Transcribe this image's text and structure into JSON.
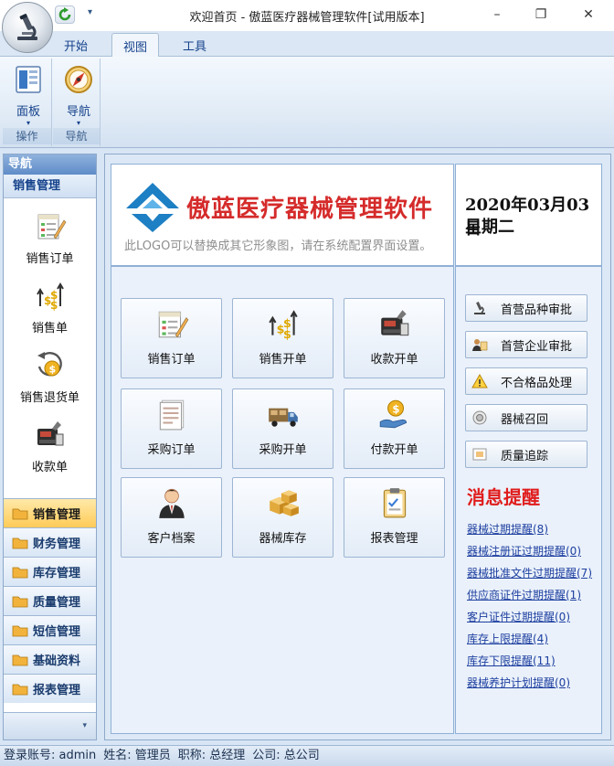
{
  "window": {
    "title": "欢迎首页 - 傲蓝医疗器械管理软件[试用版本]",
    "minimize": "–",
    "maximize": "❐",
    "close": "✕",
    "quick_access_dropdown": "▾"
  },
  "ribbon": {
    "tabs": [
      "开始",
      "视图",
      "工具"
    ],
    "active_tab": "视图",
    "groups": [
      {
        "label": "操作",
        "button": "面板",
        "icon": "panel-icon"
      },
      {
        "label": "导航",
        "button": "导航",
        "icon": "compass-icon"
      }
    ],
    "dropdown_arrow": "▾"
  },
  "nav": {
    "header": "导航",
    "section": "销售管理",
    "items": [
      {
        "label": "销售订单",
        "icon": "sales-order-icon"
      },
      {
        "label": "销售单",
        "icon": "sales-slip-icon"
      },
      {
        "label": "销售退货单",
        "icon": "sales-return-icon"
      },
      {
        "label": "收款单",
        "icon": "cash-register-icon"
      }
    ],
    "categories": [
      "销售管理",
      "财务管理",
      "库存管理",
      "质量管理",
      "短信管理",
      "基础资料",
      "报表管理"
    ],
    "active_category": "销售管理",
    "footer_arrow": "▾"
  },
  "logo": {
    "title": "傲蓝医疗器械管理软件",
    "subtitle": "此LOGO可以替换成其它形象图，请在系统配置界面设置。"
  },
  "date": {
    "date": "2020年03月03日",
    "weekday": "星期二"
  },
  "functions": [
    {
      "label": "销售订单",
      "icon": "sales-order-icon"
    },
    {
      "label": "销售开单",
      "icon": "sales-slip-icon"
    },
    {
      "label": "收款开单",
      "icon": "cash-register-icon"
    },
    {
      "label": "采购订单",
      "icon": "purchase-order-icon"
    },
    {
      "label": "采购开单",
      "icon": "truck-icon"
    },
    {
      "label": "付款开单",
      "icon": "payment-icon"
    },
    {
      "label": "客户档案",
      "icon": "customer-icon"
    },
    {
      "label": "器械库存",
      "icon": "boxes-icon"
    },
    {
      "label": "报表管理",
      "icon": "clipboard-icon"
    }
  ],
  "side_buttons": [
    {
      "label": "首营品种审批",
      "icon": "microscope-icon"
    },
    {
      "label": "首营企业审批",
      "icon": "user-card-icon"
    },
    {
      "label": "不合格品处理",
      "icon": "warning-icon"
    },
    {
      "label": "器械召回",
      "icon": "recall-icon"
    },
    {
      "label": "质量追踪",
      "icon": "tracking-icon"
    }
  ],
  "messages": {
    "title": "消息提醒",
    "items": [
      "器械过期提醒(8)",
      "器械注册证过期提醒(0)",
      "器械批准文件过期提醒(7)",
      "供应商证件过期提醒(1)",
      "客户证件过期提醒(0)",
      "库存上限提醒(4)",
      "库存下限提醒(11)",
      "器械养护计划提醒(0)"
    ]
  },
  "status": {
    "account": "登录账号: admin",
    "name": "姓名: 管理员",
    "title": "职称: 总经理",
    "company": "公司: 总公司"
  },
  "colors": {
    "accent": "#15428b",
    "logo_red": "#d52b2b",
    "message_red": "#e01c1c",
    "link_blue": "#1d3fa0",
    "active_category": "#ffcb58"
  }
}
